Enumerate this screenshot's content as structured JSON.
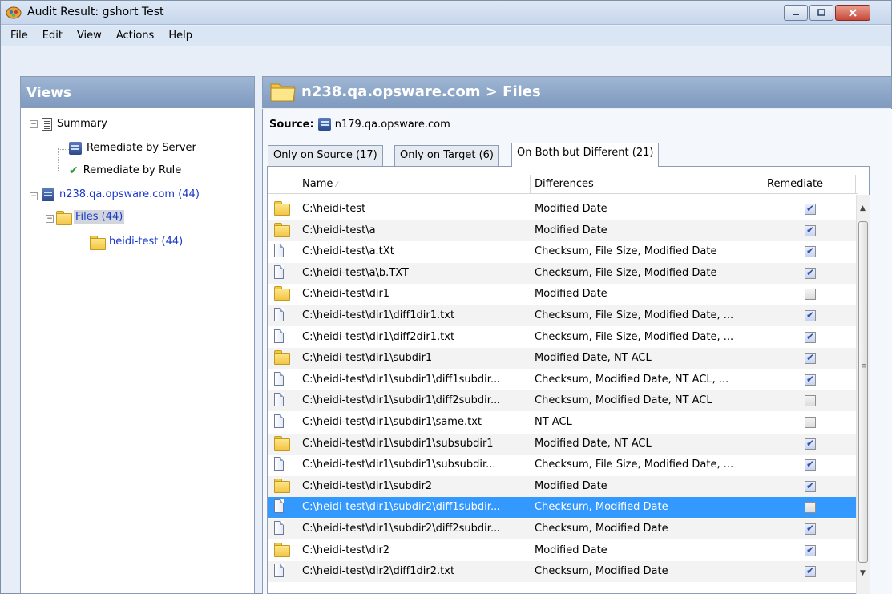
{
  "window": {
    "title": "Audit Result: gshort Test"
  },
  "menu": [
    "File",
    "Edit",
    "View",
    "Actions",
    "Help"
  ],
  "views": {
    "header": "Views",
    "tree": {
      "summary": "Summary",
      "remediate_server": "Remediate by Server",
      "remediate_rule": "Remediate by Rule",
      "server": "n238.qa.opsware.com (44)",
      "files": "Files (44)",
      "folder": "heidi-test (44)"
    }
  },
  "main": {
    "title": "n238.qa.opsware.com > Files",
    "source_label": "Source:",
    "source_value": "n179.qa.opsware.com",
    "tabs": [
      "Only on Source (17)",
      "Only on Target (6)",
      "On Both but Different (21)"
    ],
    "columns": {
      "name": "Name",
      "differences": "Differences",
      "remediate": "Remediate"
    },
    "rows": [
      {
        "type": "folder",
        "name": "C:\\heidi-test",
        "diff": "Modified Date",
        "remediate": true
      },
      {
        "type": "folder",
        "name": "C:\\heidi-test\\a",
        "diff": "Modified Date",
        "remediate": true
      },
      {
        "type": "file",
        "name": "C:\\heidi-test\\a.tXt",
        "diff": "Checksum, File Size, Modified Date",
        "remediate": true
      },
      {
        "type": "file",
        "name": "C:\\heidi-test\\a\\b.TXT",
        "diff": "Checksum, File Size, Modified Date",
        "remediate": true
      },
      {
        "type": "folder",
        "name": "C:\\heidi-test\\dir1",
        "diff": "Modified Date",
        "remediate": false
      },
      {
        "type": "file",
        "name": "C:\\heidi-test\\dir1\\diff1dir1.txt",
        "diff": "Checksum, File Size, Modified Date, ...",
        "remediate": true
      },
      {
        "type": "file",
        "name": "C:\\heidi-test\\dir1\\diff2dir1.txt",
        "diff": "Checksum, File Size, Modified Date, ...",
        "remediate": true
      },
      {
        "type": "folder",
        "name": "C:\\heidi-test\\dir1\\subdir1",
        "diff": "Modified Date, NT ACL",
        "remediate": true
      },
      {
        "type": "file",
        "name": "C:\\heidi-test\\dir1\\subdir1\\diff1subdir...",
        "diff": "Checksum, Modified Date, NT ACL, ...",
        "remediate": true
      },
      {
        "type": "file",
        "name": "C:\\heidi-test\\dir1\\subdir1\\diff2subdir...",
        "diff": "Checksum, Modified Date, NT ACL",
        "remediate": false
      },
      {
        "type": "file",
        "name": "C:\\heidi-test\\dir1\\subdir1\\same.txt",
        "diff": "NT ACL",
        "remediate": false
      },
      {
        "type": "folder",
        "name": "C:\\heidi-test\\dir1\\subdir1\\subsubdir1",
        "diff": "Modified Date, NT ACL",
        "remediate": true
      },
      {
        "type": "file",
        "name": "C:\\heidi-test\\dir1\\subdir1\\subsubdir...",
        "diff": "Checksum, File Size, Modified Date, ...",
        "remediate": true
      },
      {
        "type": "folder",
        "name": "C:\\heidi-test\\dir1\\subdir2",
        "diff": "Modified Date",
        "remediate": true
      },
      {
        "type": "file",
        "name": "C:\\heidi-test\\dir1\\subdir2\\diff1subdir...",
        "diff": "Checksum, Modified Date",
        "remediate": false,
        "selected": true
      },
      {
        "type": "file",
        "name": "C:\\heidi-test\\dir1\\subdir2\\diff2subdir...",
        "diff": "Checksum, Modified Date",
        "remediate": true
      },
      {
        "type": "folder",
        "name": "C:\\heidi-test\\dir2",
        "diff": "Modified Date",
        "remediate": true
      },
      {
        "type": "file",
        "name": "C:\\heidi-test\\dir2\\diff1dir2.txt",
        "diff": "Checksum, Modified Date",
        "remediate": true
      }
    ]
  },
  "colors": {
    "header_gradient": "#8ea8cb",
    "selection": "#3399ff",
    "link": "#1a38c9"
  }
}
